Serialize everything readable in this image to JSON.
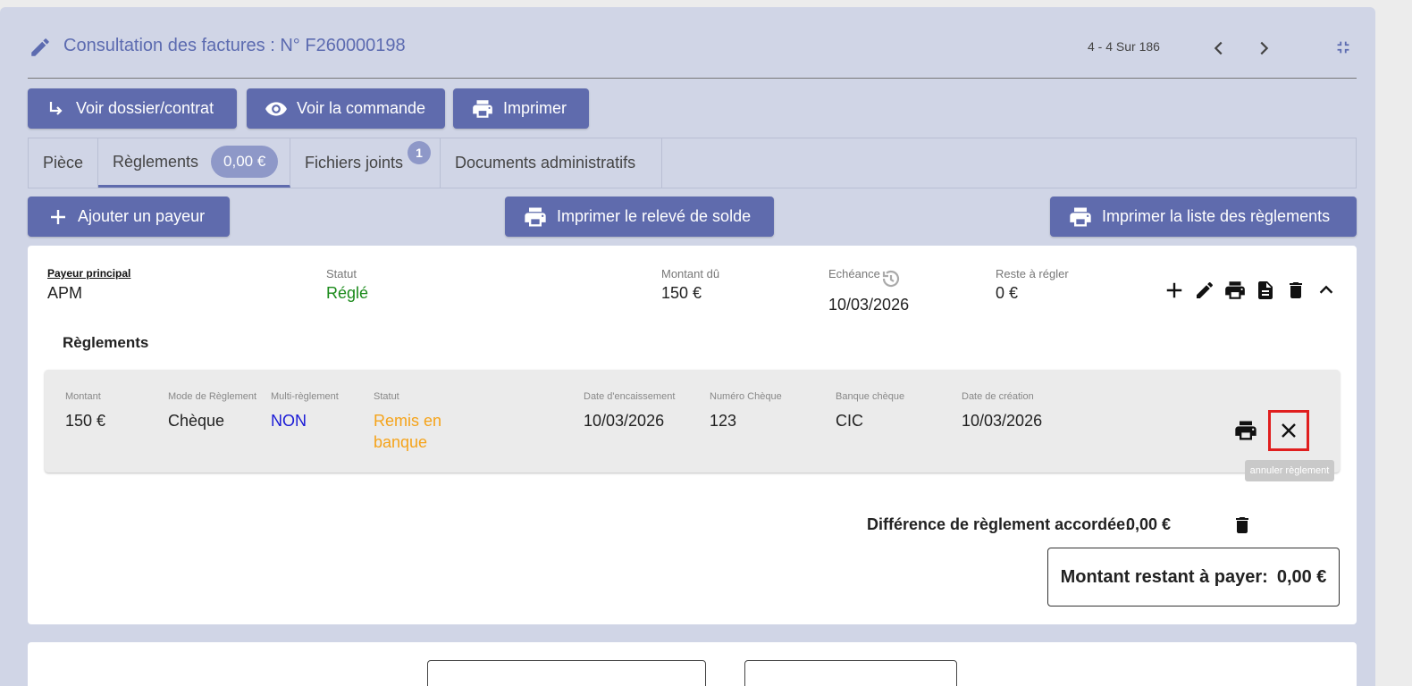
{
  "header": {
    "title": "Consultation des factures : N° F260000198",
    "pager": "4 - 4 Sur 186"
  },
  "toolbar": {
    "voir_dossier": "Voir dossier/contrat",
    "voir_commande": "Voir la commande",
    "imprimer": "Imprimer"
  },
  "tabs": {
    "piece": "Pièce",
    "reglements": "Règlements",
    "reglements_amount": "0,00 €",
    "fichiers": "Fichiers joints",
    "fichiers_count": "1",
    "documents": "Documents administratifs"
  },
  "actions": {
    "ajouter_payeur": "Ajouter un payeur",
    "imprimer_releve": "Imprimer le relevé de solde",
    "imprimer_liste": "Imprimer la liste des règlements"
  },
  "payer": {
    "payeur_label": "Payeur principal",
    "payeur_value": "APM",
    "statut_label": "Statut",
    "statut_value": "Réglé",
    "montant_label": "Montant dû",
    "montant_value": "150 €",
    "echeance_label": "Echéance",
    "echeance_value": "10/03/2026",
    "reste_label": "Reste à régler",
    "reste_value": "0 €"
  },
  "reglements_title": "Règlements",
  "payment": {
    "montant_label": "Montant",
    "montant": "150 €",
    "mode_label": "Mode de Règlement",
    "mode": "Chèque",
    "multi_label": "Multi-règlement",
    "multi": "NON",
    "statut_label": "Statut",
    "statut_line1": "Remis en",
    "statut_line2": "banque",
    "date_enc_label": "Date d'encaissement",
    "date_enc": "10/03/2026",
    "numero_label": "Numéro Chèque",
    "numero": "123",
    "banque_label": "Banque chèque",
    "banque": "CIC",
    "date_creation_label": "Date de création",
    "date_creation": "10/03/2026",
    "tooltip": "annuler règlement"
  },
  "summary": {
    "difference_label": "Différence de règlement accordée:",
    "difference_value": "0,00 €",
    "restant_label": "Montant restant à payer:",
    "restant_value": "0,00 €"
  },
  "colors": {
    "accent": "#5f6bad",
    "statut_regle": "#1a8a1a",
    "multi_non": "#1a1ad6",
    "remis_banque": "#f5a31a",
    "highlight": "#e01e1e"
  }
}
